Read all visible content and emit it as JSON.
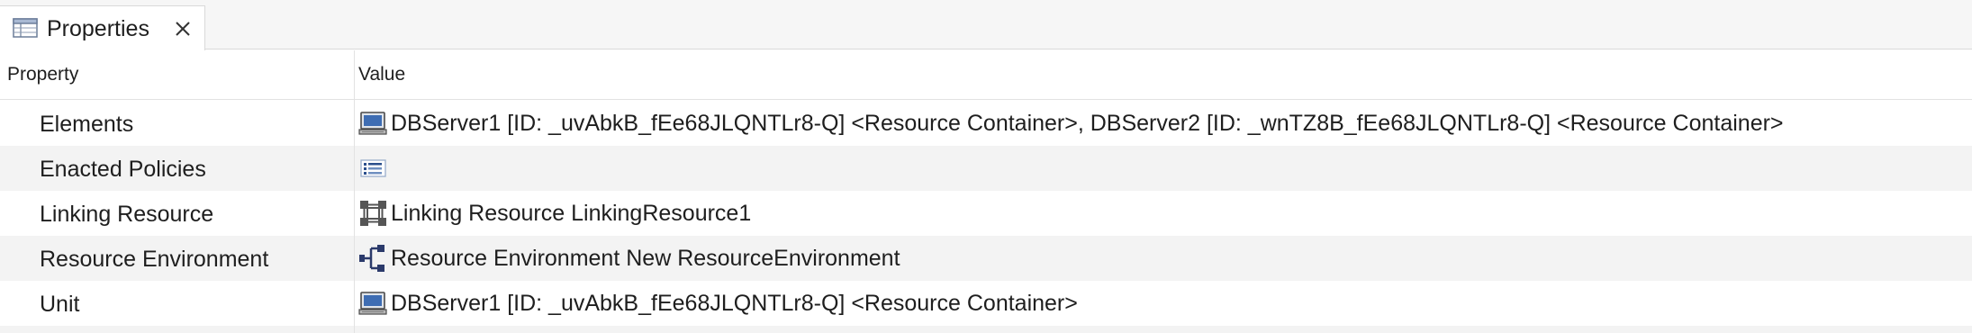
{
  "tab": {
    "title": "Properties",
    "icon": "properties-table-icon",
    "close_icon": "close-icon"
  },
  "table": {
    "headers": {
      "property": "Property",
      "value": "Value"
    },
    "rows": [
      {
        "property": "Elements",
        "value": "DBServer1 [ID: _uvAbkB_fEe68JLQNTLr8-Q] <Resource Container>, DBServer2 [ID: _wnTZ8B_fEe68JLQNTLr8-Q] <Resource Container>",
        "icon": "resource-container-icon"
      },
      {
        "property": "Enacted Policies",
        "value": "",
        "icon": "list-icon"
      },
      {
        "property": "Linking Resource",
        "value": "Linking Resource LinkingResource1",
        "icon": "linking-resource-icon"
      },
      {
        "property": "Resource Environment",
        "value": "Resource Environment New ResourceEnvironment",
        "icon": "resource-environment-icon"
      },
      {
        "property": "Unit",
        "value": "DBServer1 [ID: _uvAbkB_fEe68JLQNTLr8-Q] <Resource Container>",
        "icon": "resource-container-icon"
      }
    ]
  },
  "colors": {
    "tabbar_bg": "#f6f6f6",
    "alt_row_bg": "#f3f3f3",
    "border": "#d9d9d9",
    "icon_blue": "#2b4f8c"
  }
}
